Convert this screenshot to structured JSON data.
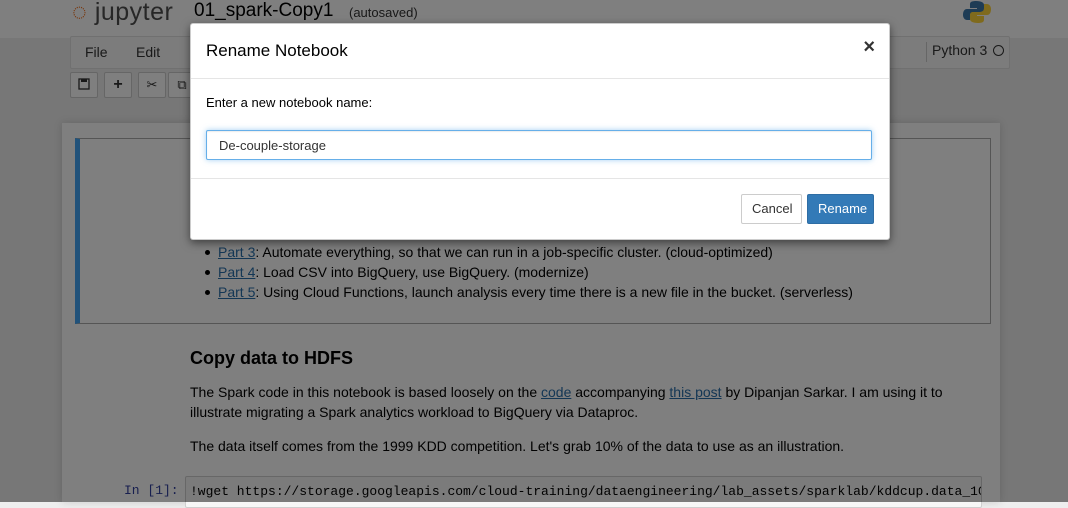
{
  "header": {
    "logo_text": "jupyter",
    "notebook_title": "01_spark-Copy1",
    "autosave_status": "(autosaved)"
  },
  "menubar": {
    "items": [
      "File",
      "Edit"
    ],
    "kernel_name": "Python 3"
  },
  "notebook": {
    "parts": [
      {
        "link": "Part 3",
        "text": ": Automate everything, so that we can run in a job-specific cluster. (cloud-optimized)"
      },
      {
        "link": "Part 4",
        "text": ": Load CSV into BigQuery, use BigQuery. (modernize)"
      },
      {
        "link": "Part 5",
        "text": ": Using Cloud Functions, launch analysis every time there is a new file in the bucket. (serverless)"
      }
    ],
    "section_heading": "Copy data to HDFS",
    "para1": {
      "t1": "The Spark code in this notebook is based loosely on the ",
      "link1": "code",
      "t2": " accompanying ",
      "link2": "this post",
      "t3": " by Dipanjan Sarkar. I am using it to illustrate migrating a Spark analytics workload to BigQuery via Dataproc."
    },
    "para2": "The data itself comes from the 1999 KDD competition. Let's grab 10% of the data to use as an illustration.",
    "code_prompt": "In [1]:",
    "code_line": "!wget https://storage.googleapis.com/cloud-training/dataengineering/lab_assets/sparklab/kddcup.data_10_"
  },
  "modal": {
    "title": "Rename Notebook",
    "close_symbol": "×",
    "label": "Enter a new notebook name:",
    "input_value": "De-couple-storage",
    "cancel_label": "Cancel",
    "rename_label": "Rename"
  },
  "colors": {
    "primary_button": "#337ab7",
    "link": "#296eaa",
    "selected_cell_border": "#42a5f5",
    "jupyter_orange": "#f37626"
  }
}
